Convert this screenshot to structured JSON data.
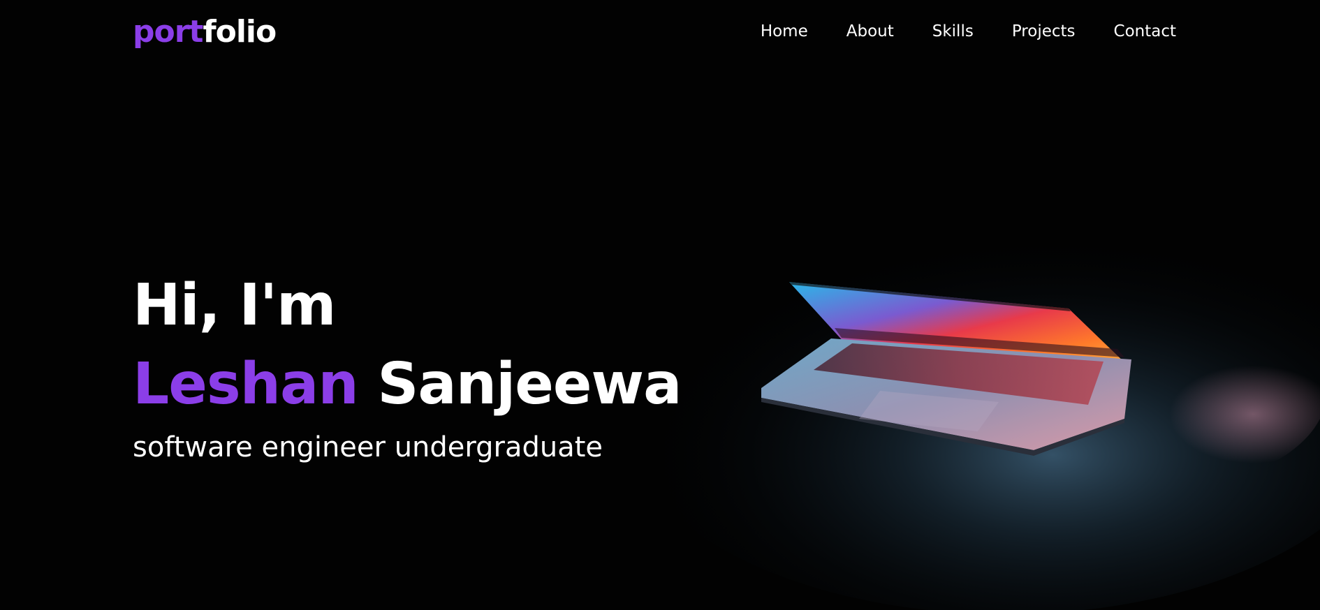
{
  "logo": {
    "part1": "port",
    "part2": "folio"
  },
  "nav": {
    "items": [
      {
        "label": "Home"
      },
      {
        "label": "About"
      },
      {
        "label": "Skills"
      },
      {
        "label": "Projects"
      },
      {
        "label": "Contact"
      }
    ]
  },
  "hero": {
    "greeting": "Hi, I'm",
    "first_name": "Leshan",
    "last_name": "Sanjeewa",
    "role": "software engineer undergraduate"
  },
  "colors": {
    "accent": "#8b3ee8",
    "background": "#020202",
    "text": "#ffffff"
  }
}
